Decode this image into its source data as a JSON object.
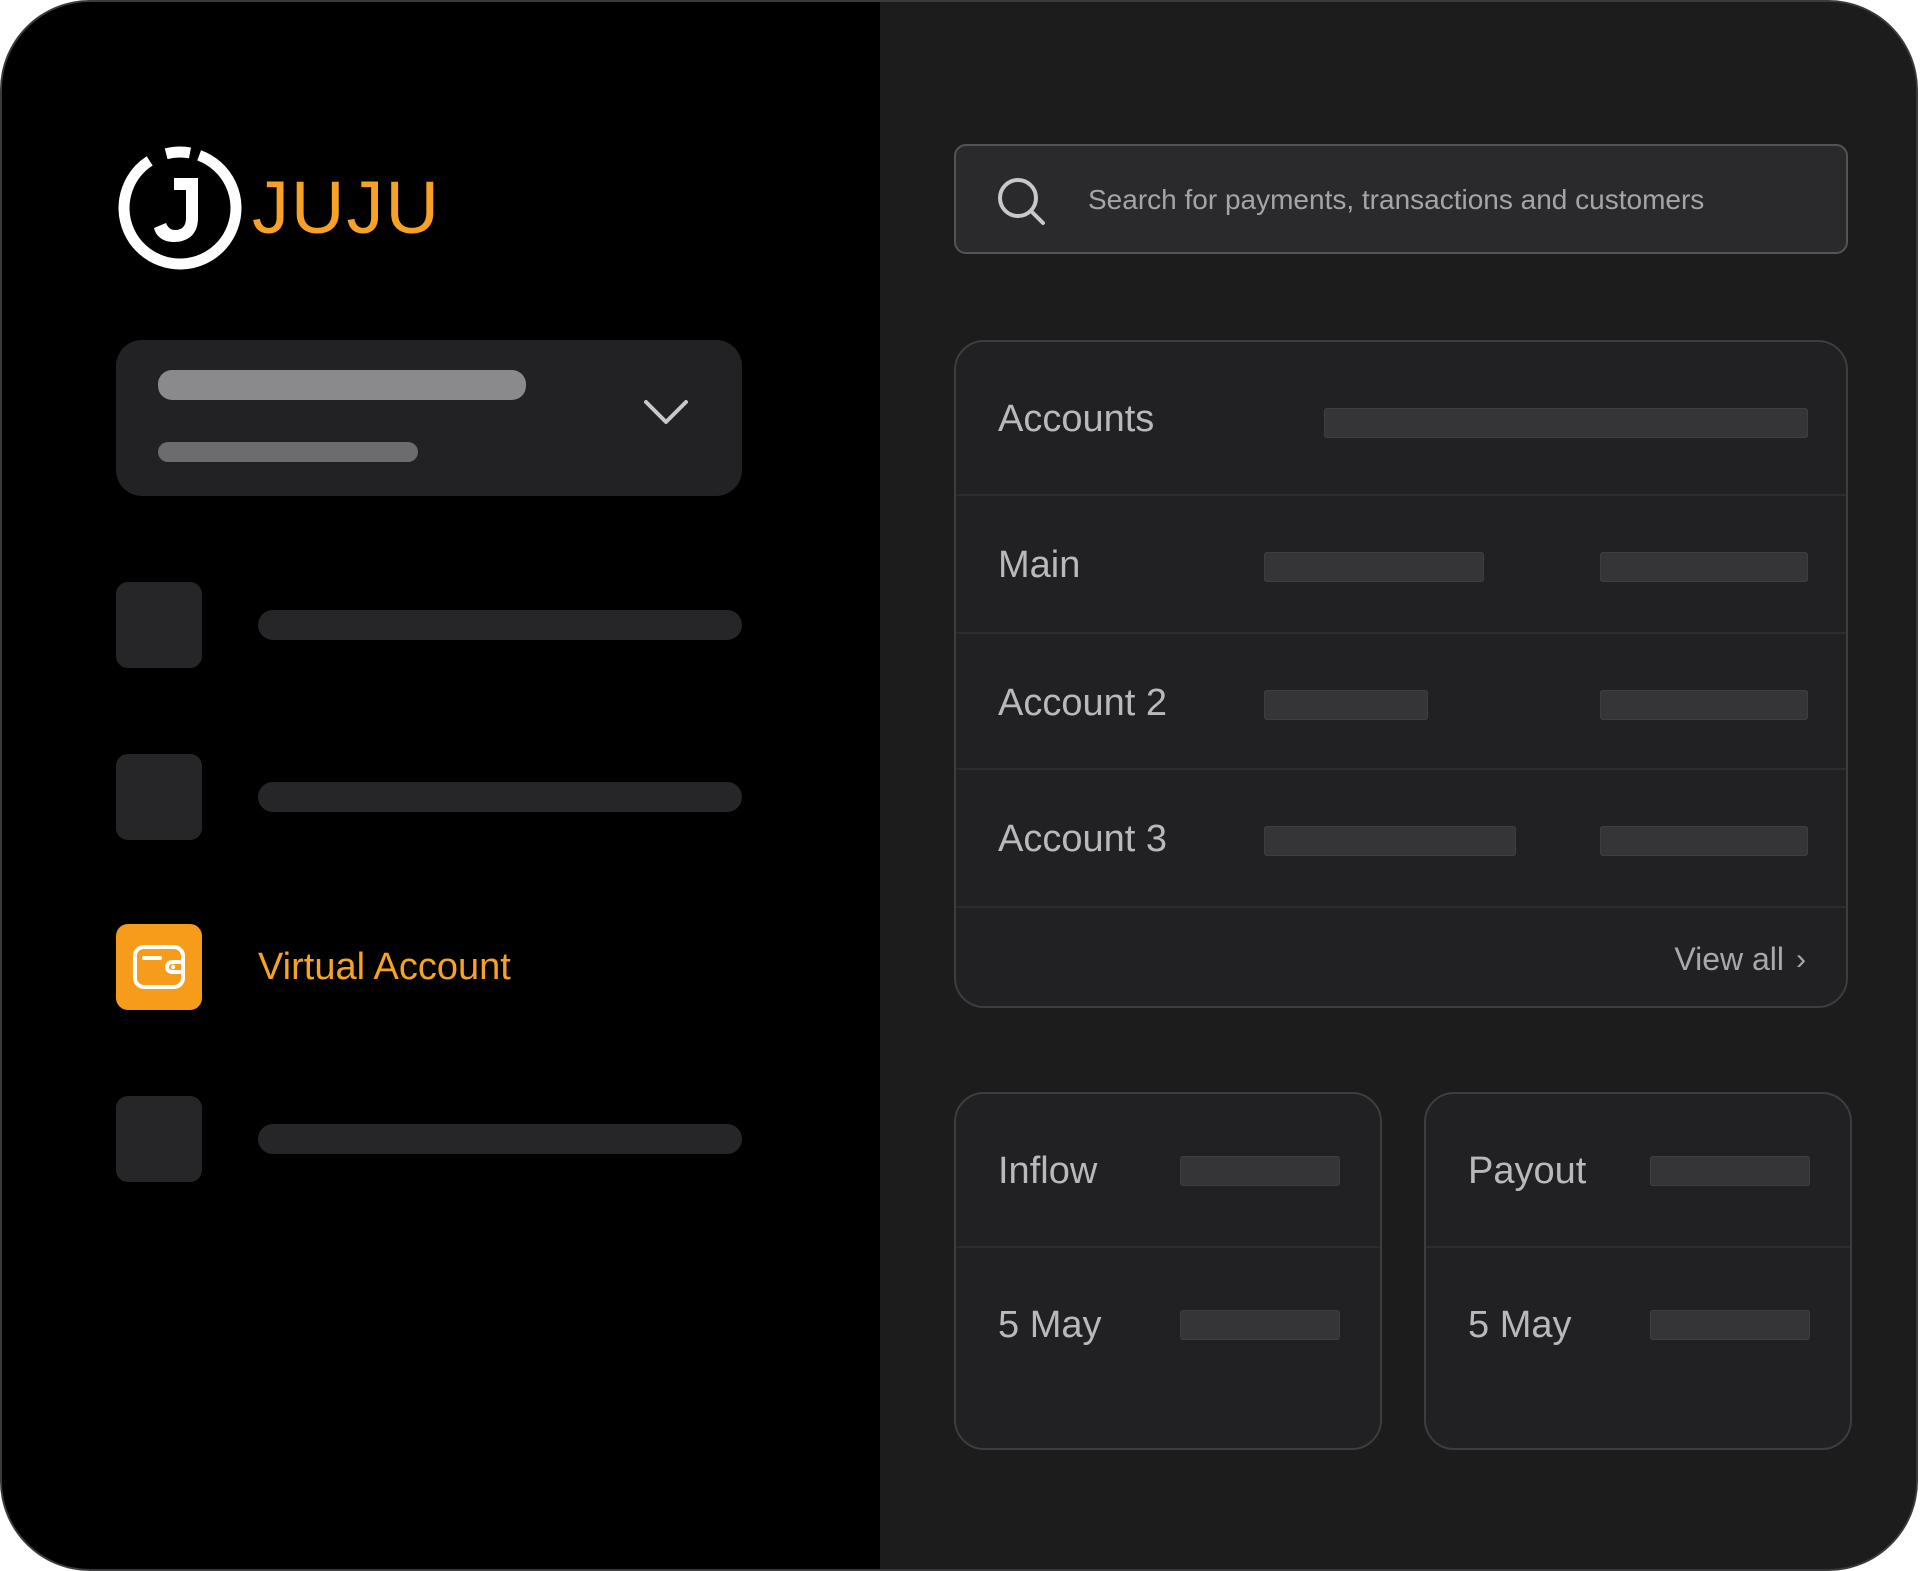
{
  "brand": {
    "name": "JUJU",
    "accent_color": "#f7a224",
    "logo_icon": "juju-logo-icon"
  },
  "sidebar": {
    "workspace_selector": {
      "icon": "chevron-down-icon"
    },
    "nav": [
      {
        "id": "nav-placeholder-1",
        "active": false
      },
      {
        "id": "nav-placeholder-2",
        "active": false
      },
      {
        "id": "virtual-account",
        "label": "Virtual Account",
        "icon": "wallet-icon",
        "active": true
      },
      {
        "id": "nav-placeholder-4",
        "active": false
      }
    ]
  },
  "search": {
    "placeholder": "Search for payments, transactions and customers",
    "icon": "search-icon"
  },
  "accounts": {
    "title": "Accounts",
    "rows": [
      {
        "label": "Main"
      },
      {
        "label": "Account 2"
      },
      {
        "label": "Account 3"
      }
    ],
    "view_all": "View all",
    "view_all_icon": "chevron-right-icon"
  },
  "inflow": {
    "title": "Inflow",
    "date": "5 May"
  },
  "payout": {
    "title": "Payout",
    "date": "5 May"
  }
}
